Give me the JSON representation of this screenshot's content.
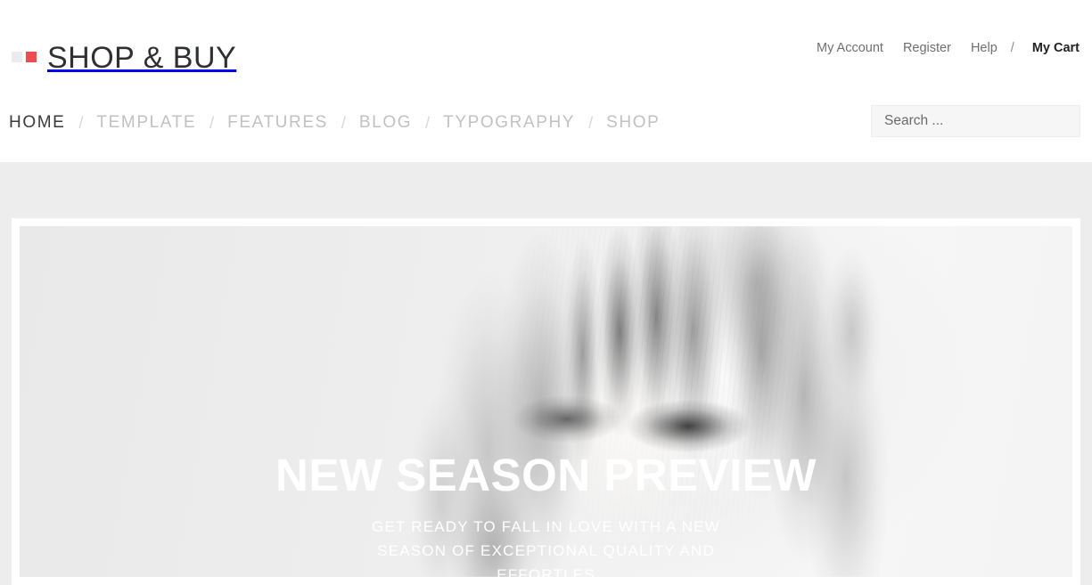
{
  "header": {
    "logo": {
      "text": "SHOP & BUY",
      "mark_color_light": "#ececec",
      "mark_color_accent": "#ef4d4d"
    },
    "utility_nav": {
      "items": [
        {
          "label": "My Account"
        },
        {
          "label": "Register"
        },
        {
          "label": "Help"
        }
      ],
      "separator": "/",
      "cart_label": "My Cart"
    },
    "main_nav": {
      "separator": "/",
      "items": [
        {
          "label": "HOME",
          "active": true
        },
        {
          "label": "TEMPLATE",
          "active": false
        },
        {
          "label": "FEATURES",
          "active": false
        },
        {
          "label": "BLOG",
          "active": false
        },
        {
          "label": "TYPOGRAPHY",
          "active": false
        },
        {
          "label": "SHOP",
          "active": false
        }
      ]
    },
    "search": {
      "placeholder": "Search ...",
      "value": ""
    }
  },
  "hero": {
    "title": "NEW SEASON PREVIEW",
    "subtitle": "GET READY TO FALL IN LOVE WITH A NEW SEASON OF EXCEPTIONAL QUALITY AND EFFORTLES",
    "image_alt": "Black and white portrait of a woman wearing sunglasses and a knit hood",
    "background_color": "#ededed",
    "frame_color": "#ffffff"
  }
}
